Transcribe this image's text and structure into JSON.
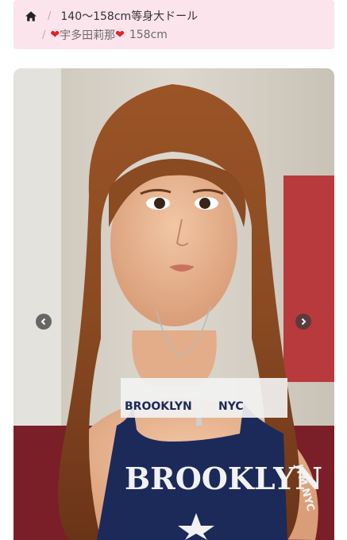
{
  "breadcrumb": {
    "category": "140〜158cm等身大ドール",
    "current_name": "宇多田莉那",
    "heart_glyph": "❤",
    "current_size": "158cm",
    "separator": "/"
  },
  "carousel": {
    "image_icon": "doll-photo",
    "shirt_text_small": "BROOKLYN",
    "shirt_text_nyc": "NYC",
    "shirt_text_large": "BROOKLYN",
    "shirt_side_text": "JTM NYC"
  },
  "colors": {
    "breadcrumb_bg": "#fce4ec",
    "heart": "#e0202a",
    "hair": "#8a4a22",
    "shirt": "#1c2a5a"
  }
}
